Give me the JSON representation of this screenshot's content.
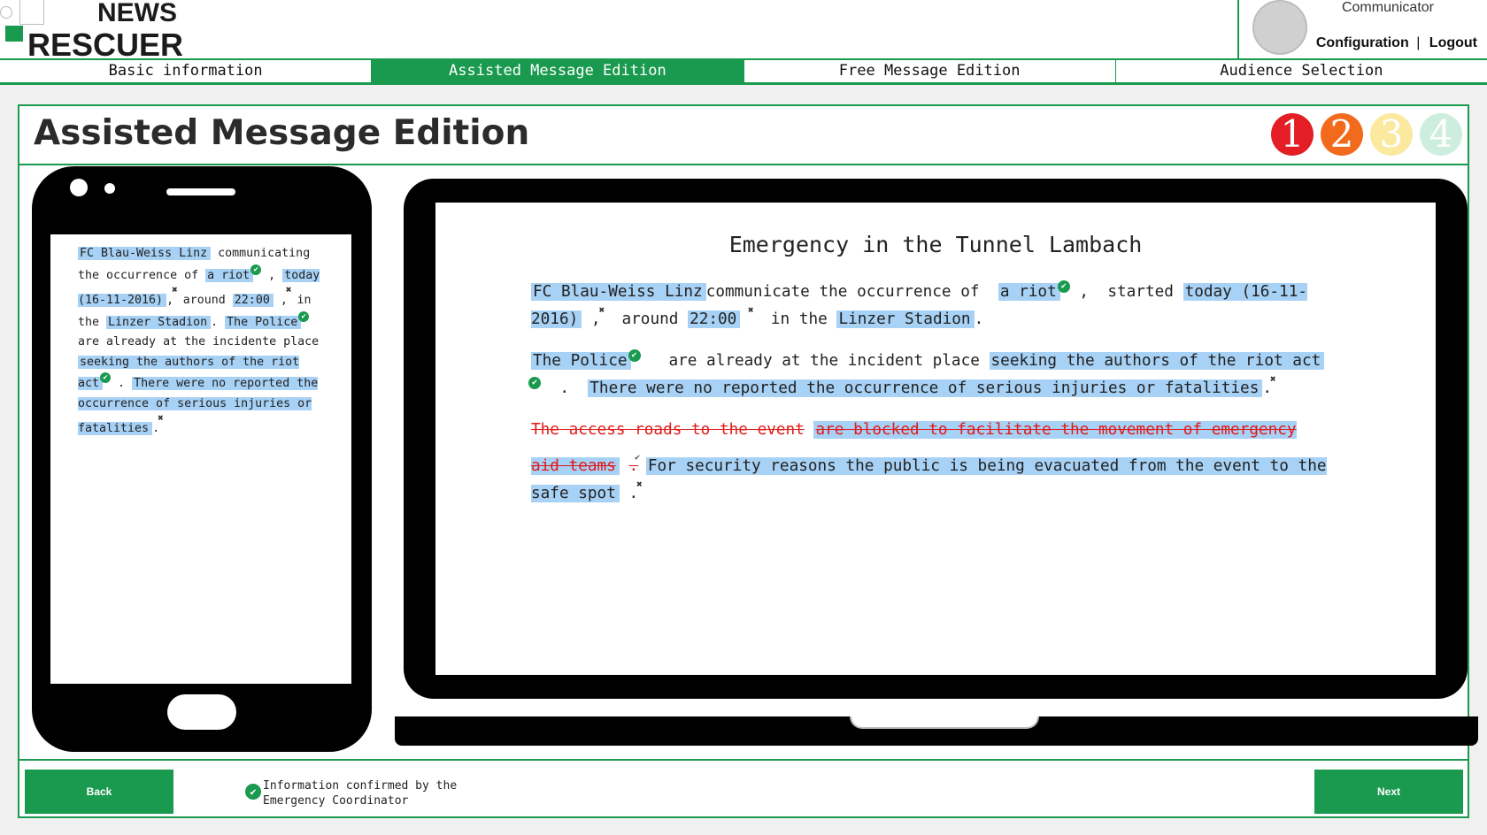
{
  "brand": {
    "line1": "NEWS",
    "line2": "RESCUER"
  },
  "user": {
    "role": "Communicator",
    "configuration": "Configuration",
    "separator": "|",
    "logout": "Logout"
  },
  "tabs": [
    {
      "label": "Basic information",
      "active": false
    },
    {
      "label": "Assisted Message Edition",
      "active": true
    },
    {
      "label": "Free Message Edition",
      "active": false
    },
    {
      "label": "Audience Selection",
      "active": false
    }
  ],
  "page": {
    "title": "Assisted Message Edition"
  },
  "steps": [
    {
      "label": "1",
      "color": "#e31e24"
    },
    {
      "label": "2",
      "color": "#f26a1b"
    },
    {
      "label": "3",
      "color": "#fbe9a0"
    },
    {
      "label": "4",
      "color": "#cdeede"
    }
  ],
  "phone": {
    "t1": "FC Blau-Weiss Linz",
    "t2": "communicating the occurrence of",
    "t3": "a riot",
    "t4": ",",
    "t5": "today (16-11-2016)",
    "t6": ",",
    "t7": "around",
    "t8": "22:00",
    "t9": ",",
    "t10": "in the",
    "t11": "Linzer Stadion",
    "t12": ".",
    "t13": "The Police",
    "t14": "are already at the incidente place",
    "t15": "seeking the authors of the riot act",
    "t16": ".",
    "t17": "There were no reported the occurrence of serious injuries or fatalities",
    "t18": "."
  },
  "laptop": {
    "title": "Emergency in the Tunnel Lambach",
    "p1": {
      "a": "FC Blau-Weiss Linz",
      "b": "communicate the occurrence of",
      "c": "a riot",
      "d": ",",
      "e": "started",
      "f": "today (16-11-2016)",
      "g": ",",
      "h": "around",
      "i": "22:00",
      "j": "in the",
      "k": "Linzer Stadion",
      "l": "."
    },
    "p2": {
      "a": "The Police",
      "b": "are already at the incident place",
      "c": "seeking the authors of the riot act",
      "d": ".",
      "e": "There were no reported the occurrence of serious injuries or fatalities",
      "f": "."
    },
    "p3": {
      "a": "The access roads to the event",
      "b": "are blocked to facilitate the movement of emergency aid teams",
      "c": ".",
      "d": "For security reasons the public is being evacuated from the event to the safe spot",
      "e": "."
    }
  },
  "footer": {
    "back": "Back",
    "next": "Next",
    "legend": "Information confirmed by the Emergency Coordinator"
  },
  "icons": {
    "confirmed": "check-circle-icon",
    "remove": "close-x-icon"
  }
}
